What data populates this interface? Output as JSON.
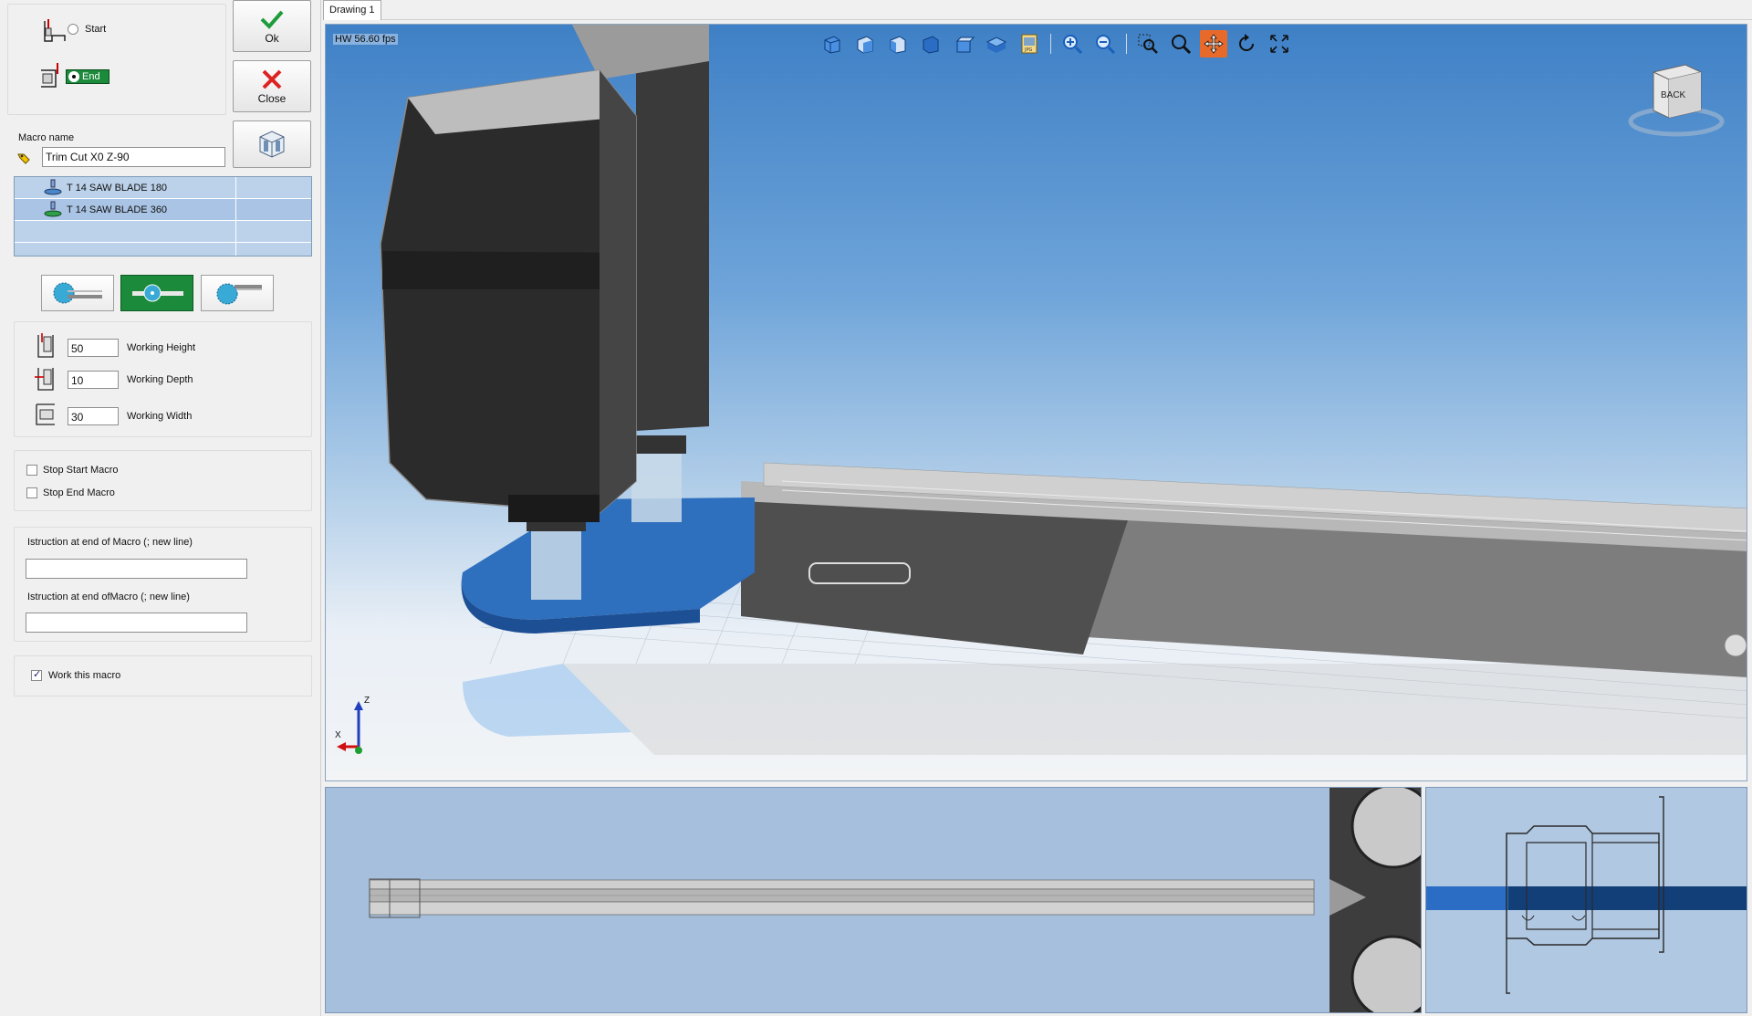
{
  "macro_panel": {
    "start_label": "Start",
    "end_label": "End",
    "ok_label": "Ok",
    "close_label": "Close",
    "macro_name_label": "Macro name",
    "macro_name_value": "Trim Cut X0 Z-90",
    "tools": [
      {
        "label": "T 14 SAW BLADE 180",
        "selected": false
      },
      {
        "label": "T 14 SAW BLADE 360",
        "selected": true
      }
    ],
    "working_height": {
      "label": "Working Height",
      "value": "50"
    },
    "working_depth": {
      "label": "Working Depth",
      "value": "10"
    },
    "working_width": {
      "label": "Working Width",
      "value": "30"
    },
    "stop_start_macro": {
      "label": "Stop Start Macro",
      "checked": false
    },
    "stop_end_macro": {
      "label": "Stop End Macro",
      "checked": false
    },
    "instruction_1_label": "Istruction at end of Macro (; new line)",
    "instruction_1_value": "",
    "instruction_2_label": "Istruction at end ofMacro (; new line)",
    "instruction_2_value": "",
    "work_this_macro": {
      "label": "Work this macro",
      "checked": true
    }
  },
  "tabs": [
    {
      "label": "Drawing  1"
    }
  ],
  "viewport": {
    "fps_label": "HW 56.60 fps",
    "viewcube_label": "BACK",
    "axis_z": "Z",
    "axis_x": "X",
    "toolbar_icons": [
      "view-front-icon",
      "view-right-icon",
      "view-left-icon",
      "view-back-icon",
      "view-top-icon",
      "view-iso-icon",
      "export-jpg-icon",
      "zoom-in-icon",
      "zoom-out-icon",
      "zoom-window-icon",
      "zoom-icon",
      "pan-icon",
      "rotate-icon",
      "fit-all-icon"
    ],
    "active_tool": "pan-icon"
  },
  "colors": {
    "accent_green": "#1b8a3a",
    "viewport_sky_top": "#3f80c6",
    "blade_blue": "#2e6fbe",
    "pan_active": "#e86a2b"
  }
}
